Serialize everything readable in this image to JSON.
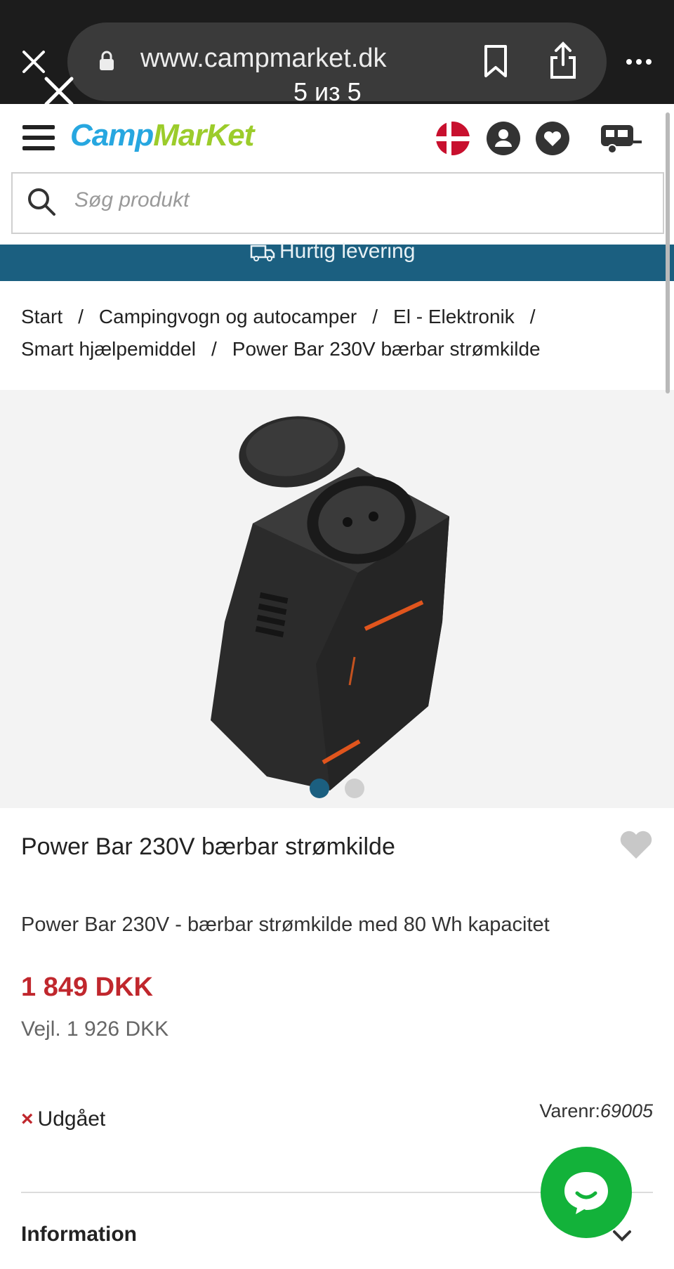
{
  "browser": {
    "url": "www.campmarket.dk",
    "counter": "5 из 5"
  },
  "site": {
    "logo_camp": "Camp",
    "logo_market": "MarKet",
    "search_placeholder": "Søg produkt",
    "ribbon_text": "Hurtig levering"
  },
  "breadcrumb": [
    "Start",
    "Campingvogn og autocamper",
    "El - Elektronik",
    "Smart hjælpemiddel",
    "Power Bar 230V bærbar strømkilde"
  ],
  "gallery": {
    "current": 1,
    "total": 2
  },
  "product": {
    "title": "Power Bar 230V bærbar strømkilde",
    "description": "Power Bar 230V - bærbar strømkilde med 80 Wh kapacitet",
    "price": "1 849 DKK",
    "rrp": "Vejl. 1 926 DKK",
    "status_mark": "×",
    "status": "Udgået",
    "sku_label": "Varenr:",
    "sku": "69005"
  },
  "sections": {
    "information": "Information"
  },
  "colors": {
    "accent_blue": "#1b5f80",
    "price_red": "#c0272d",
    "chat_green": "#13b23a",
    "logo_blue": "#27a7e0",
    "logo_green": "#9ccc2b"
  }
}
